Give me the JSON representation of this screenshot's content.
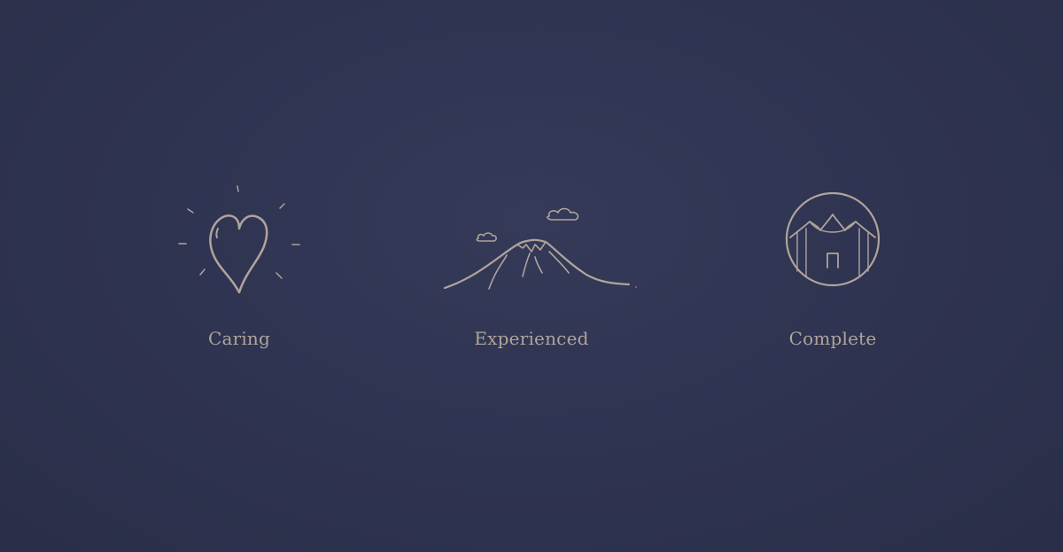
{
  "colors": {
    "background": "#2f3452",
    "accent": "#b0a49c"
  },
  "features": [
    {
      "label": "Caring",
      "icon": "heart-icon"
    },
    {
      "label": "Experienced",
      "icon": "mountain-icon"
    },
    {
      "label": "Complete",
      "icon": "tent-circle-icon"
    }
  ]
}
